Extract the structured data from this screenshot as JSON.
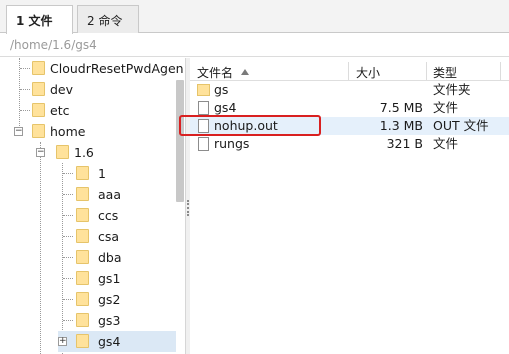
{
  "tabs": [
    {
      "label": "1 文件",
      "active": true
    },
    {
      "label": "2 命令",
      "active": false
    }
  ],
  "path": "/home/1.6/gs4",
  "tree": {
    "items": [
      {
        "label": "CloudrResetPwdAgen"
      },
      {
        "label": "dev"
      },
      {
        "label": "etc"
      },
      {
        "label": "home",
        "expander": "−"
      },
      {
        "label": "1.6",
        "expander": "−"
      },
      {
        "label": "1"
      },
      {
        "label": "aaa"
      },
      {
        "label": "ccs"
      },
      {
        "label": "csa"
      },
      {
        "label": "dba"
      },
      {
        "label": "gs1"
      },
      {
        "label": "gs2"
      },
      {
        "label": "gs3"
      },
      {
        "label": "gs4",
        "expander": "+",
        "selected": true
      }
    ]
  },
  "files": {
    "columns": {
      "name": "文件名",
      "size": "大小",
      "type": "类型"
    },
    "rows": [
      {
        "name": "gs",
        "size": "",
        "type": "文件夹",
        "icon": "folder-icon"
      },
      {
        "name": "gs4",
        "size": "7.5 MB",
        "type": "文件",
        "icon": "file-icon"
      },
      {
        "name": "nohup.out",
        "size": "1.3 MB",
        "type": "OUT 文件",
        "icon": "file-icon",
        "highlighted": true
      },
      {
        "name": "rungs",
        "size": "321 B",
        "type": "文件",
        "icon": "file-icon"
      }
    ]
  },
  "colors": {
    "highlight_box": "#d92020",
    "folder": "#ffe29b",
    "selection": "#dbe8f5"
  }
}
